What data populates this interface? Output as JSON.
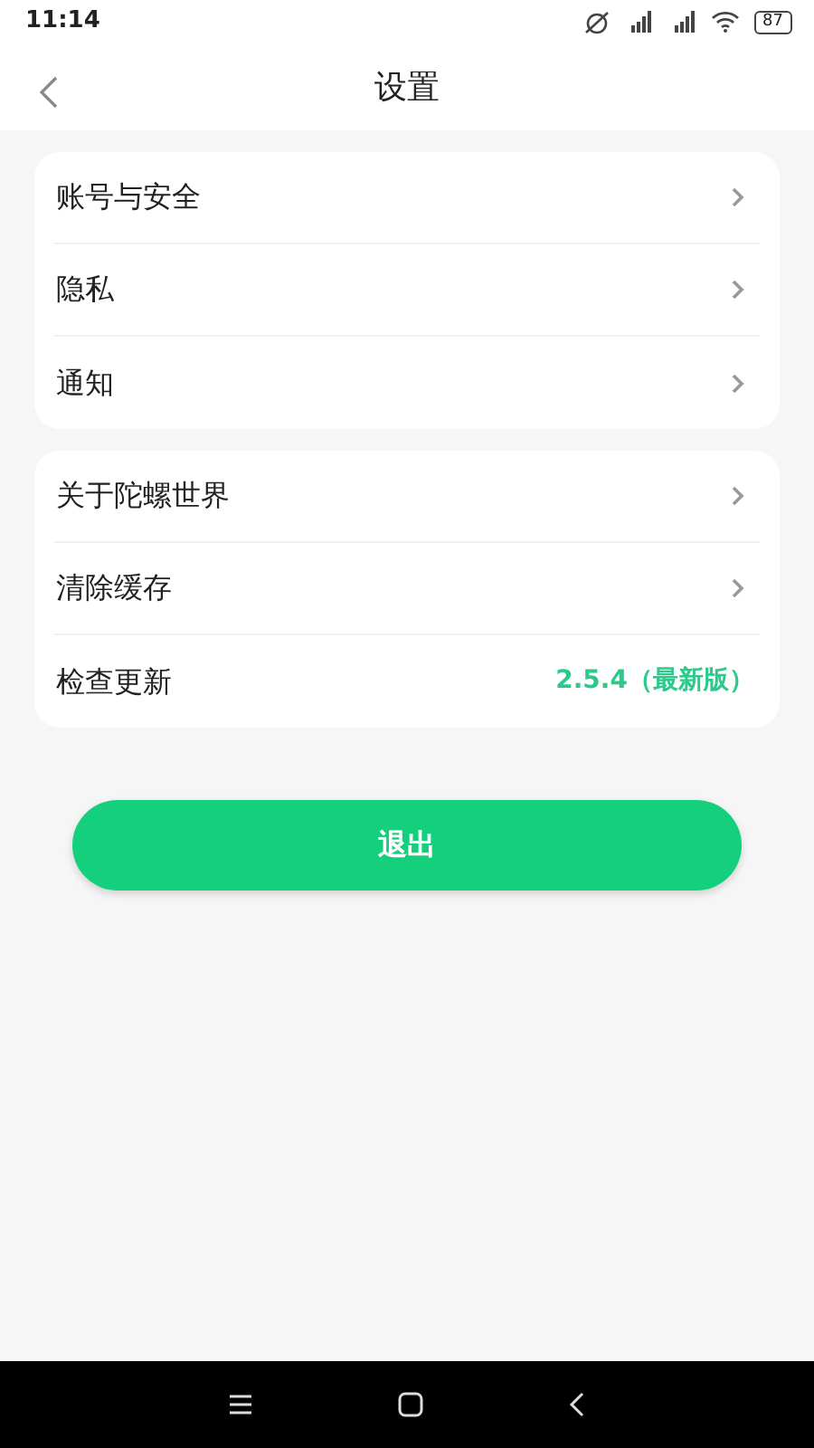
{
  "status_bar": {
    "time": "11:14",
    "battery": "87"
  },
  "header": {
    "title": "设置"
  },
  "groups": [
    {
      "rows": [
        {
          "label": "账号与安全",
          "kind": "link"
        },
        {
          "label": "隐私",
          "kind": "link"
        },
        {
          "label": "通知",
          "kind": "link"
        }
      ]
    },
    {
      "rows": [
        {
          "label": "关于陀螺世界",
          "kind": "link"
        },
        {
          "label": "清除缓存",
          "kind": "link"
        },
        {
          "label": "检查更新",
          "kind": "value",
          "value": "2.5.4（最新版）"
        }
      ]
    }
  ],
  "logout_button": "退出"
}
